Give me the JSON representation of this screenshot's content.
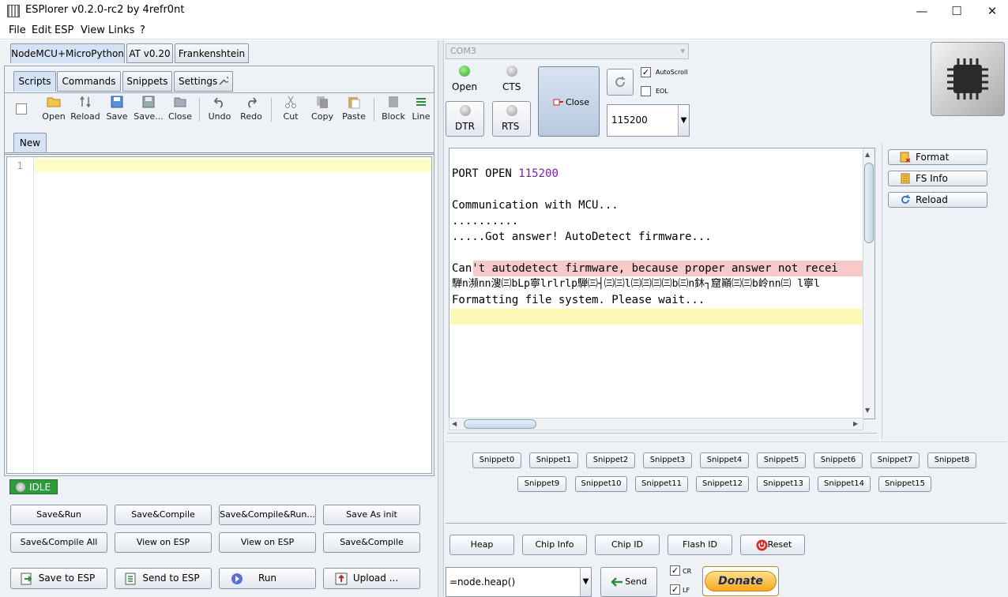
{
  "window": {
    "title": "ESPlorer v0.2.0-rc2 by 4refr0nt",
    "minimize": "—",
    "maximize": "☐",
    "close": "✕"
  },
  "menu": [
    "File",
    "Edit",
    "ESP",
    "View",
    "Links",
    "?"
  ],
  "firmware_tabs": [
    "NodeMCU+MicroPython",
    "AT v0.20",
    "Frankenshtein"
  ],
  "sub_tabs": [
    "Scripts",
    "Commands",
    "Snippets",
    "Settings"
  ],
  "toolbar": [
    "Open",
    "Reload",
    "Save",
    "Save...",
    "Close",
    "Undo",
    "Redo",
    "Cut",
    "Copy",
    "Paste",
    "Block",
    "Line"
  ],
  "file_tab": "New",
  "editor": {
    "line_number": "1"
  },
  "status": "IDLE",
  "script_buttons_row1": [
    "Save&Run",
    "Save&Compile",
    "Save&Compile&Run...",
    "Save As init"
  ],
  "script_buttons_row2": [
    "Save&Compile All",
    "View on ESP",
    "View on ESP",
    "Save&Compile"
  ],
  "script_buttons_row3": [
    "Save to ESP",
    "Send to ESP",
    "Run",
    "Upload ..."
  ],
  "port": {
    "value": "COM3",
    "open": "Open",
    "cts": "CTS",
    "dtr": "DTR",
    "rts": "RTS",
    "close": "Close",
    "autoscroll": "AutoScroll",
    "eol": "EOL",
    "baud": "115200"
  },
  "terminal": {
    "lines": [
      {
        "text": "PORT OPEN ",
        "num": "115200"
      },
      {
        "text": "Communication with MCU..."
      },
      {
        "text": ".........."
      },
      {
        "text": ".....Got answer! AutoDetect firmware..."
      },
      {
        "text": "Can't autodetect firmware, because proper answer not recei"
      },
      {
        "text": "騨n瀕nn溲㈢bLp寧lrlrlp騨㈢┤㈢㈢l㈢㈢㈢㈢b㈢n鈢┐窟巓㈢㈢b岭nn㈢ l寧l"
      },
      {
        "text": "Formatting file system. Please wait..."
      }
    ]
  },
  "side_buttons": [
    "Format",
    "FS Info",
    "Reload"
  ],
  "snippets_row1": [
    "Snippet0",
    "Snippet1",
    "Snippet2",
    "Snippet3",
    "Snippet4",
    "Snippet5",
    "Snippet6",
    "Snippet7",
    "Snippet8"
  ],
  "snippets_row2": [
    "Snippet9",
    "Snippet10",
    "Snippet11",
    "Snippet12",
    "Snippet13",
    "Snippet14",
    "Snippet15"
  ],
  "bottom_buttons": [
    "Heap",
    "Chip Info",
    "Chip ID",
    "Flash ID",
    "Reset"
  ],
  "command": {
    "value": "=node.heap()",
    "send": "Send",
    "cr": "CR",
    "lf": "LF",
    "donate": "Donate"
  },
  "colors": {
    "accent_green": "#2e9a3c",
    "port_number": "#7a1fa2",
    "error_bg": "#f7c9c9",
    "current_line": "#fdfdc8"
  }
}
